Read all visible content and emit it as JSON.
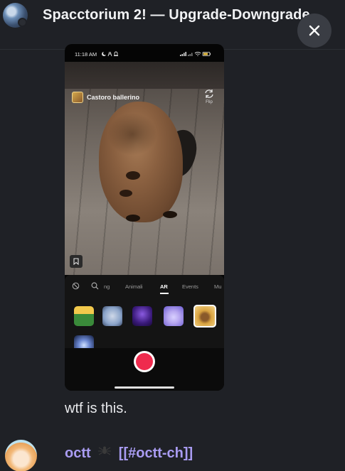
{
  "header": {
    "title": "Spacctorium 2! — Upgrade-Downgrade",
    "close_icon": "close-icon"
  },
  "attachment": {
    "status_bar": {
      "time": "11:18 AM",
      "left_icons": [
        "moon-icon",
        "network-icon",
        "bell-icon"
      ],
      "right_icons": [
        "signal-icon",
        "signal-icon",
        "wifi-icon",
        "battery-icon"
      ]
    },
    "effect_name": "Castoro ballerino",
    "flip_label": "Flip",
    "tabs": [
      "ng",
      "Animali",
      "AR",
      "Events",
      "Mu"
    ],
    "active_tab": "AR",
    "effects": [
      {
        "icon": "game-scene-effect",
        "colors": [
          "#3a8a3a",
          "#f2c94c"
        ]
      },
      {
        "icon": "dragon-effect",
        "colors": [
          "#8aa3c8",
          "#cfd8e8"
        ]
      },
      {
        "icon": "ufo-effect",
        "colors": [
          "#3a1a7a",
          "#8a5ae0"
        ]
      },
      {
        "icon": "hand-effect",
        "colors": [
          "#6a5ad0",
          "#b8a8f0"
        ]
      },
      {
        "icon": "beaver-effect",
        "colors": [
          "#d9a441",
          "#f3d48a"
        ],
        "selected": true
      },
      {
        "icon": "cube-effect",
        "colors": [
          "#101a3a",
          "#6a86d0"
        ]
      }
    ]
  },
  "message": {
    "text": "wtf is this."
  },
  "next_message": {
    "username": "octt",
    "channel": "[[#octt-ch]]"
  },
  "colors": {
    "background": "#1f2126",
    "username": "#a99cf2",
    "record": "#ef2b4e"
  }
}
